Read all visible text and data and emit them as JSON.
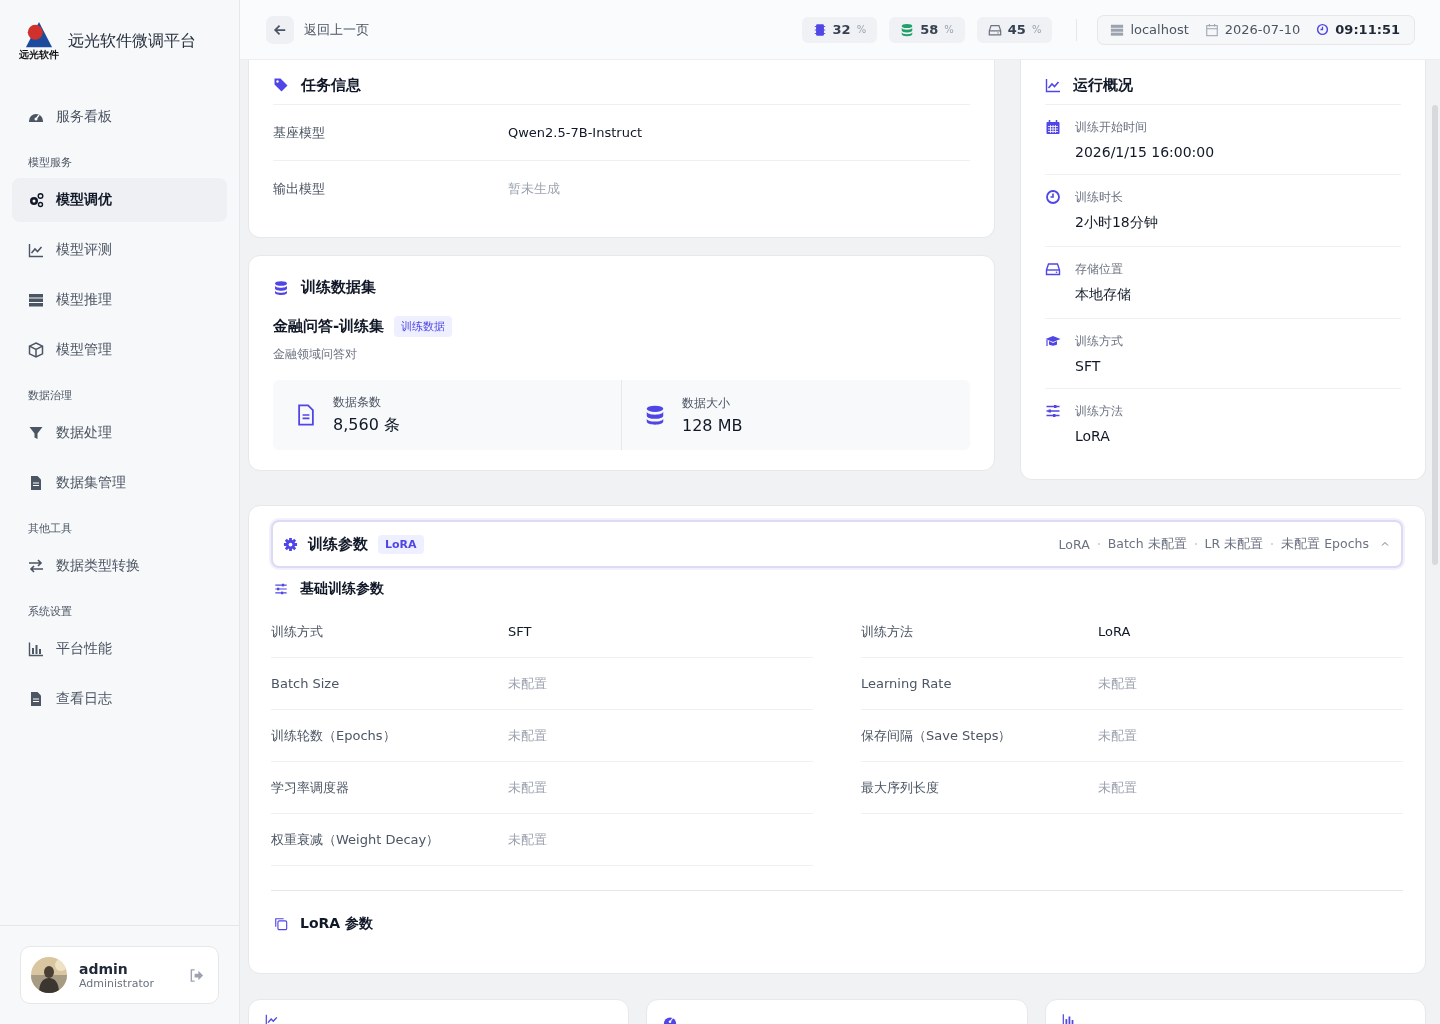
{
  "brand": {
    "logo_caption": "远光软件",
    "title": "远光软件微调平台"
  },
  "sidebar": {
    "items": [
      {
        "kind": "item",
        "label": "服务看板",
        "selected": false
      },
      {
        "kind": "section",
        "label": "模型服务"
      },
      {
        "kind": "item",
        "label": "模型调优",
        "selected": true
      },
      {
        "kind": "item",
        "label": "模型评测",
        "selected": false
      },
      {
        "kind": "item",
        "label": "模型推理",
        "selected": false
      },
      {
        "kind": "item",
        "label": "模型管理",
        "selected": false
      },
      {
        "kind": "section",
        "label": "数据治理"
      },
      {
        "kind": "item",
        "label": "数据处理",
        "selected": false
      },
      {
        "kind": "item",
        "label": "数据集管理",
        "selected": false
      },
      {
        "kind": "section",
        "label": "其他工具"
      },
      {
        "kind": "item",
        "label": "数据类型转换",
        "selected": false
      },
      {
        "kind": "section",
        "label": "系统设置"
      },
      {
        "kind": "item",
        "label": "平台性能",
        "selected": false
      },
      {
        "kind": "item",
        "label": "查看日志",
        "selected": false
      }
    ],
    "user": {
      "name": "admin",
      "role": "Administrator"
    }
  },
  "header": {
    "back": "返回上一页",
    "metrics": [
      {
        "kind": "gpu",
        "value": "32",
        "unit": "%"
      },
      {
        "kind": "db",
        "value": "58",
        "unit": "%"
      },
      {
        "kind": "disk",
        "value": "45",
        "unit": "%"
      }
    ],
    "host": "localhost",
    "date": "2026-07-10",
    "time": "09:11:51"
  },
  "task_info": {
    "title": "任务信息",
    "rows": [
      {
        "label": "基座模型",
        "value": "Qwen2.5-7B-Instruct",
        "muted": false
      },
      {
        "label": "输出模型",
        "value": "暂未生成",
        "muted": true
      }
    ]
  },
  "dataset": {
    "title": "训练数据集",
    "name": "金融问答-训练集",
    "tag": "训练数据",
    "description": "金融领域问答对",
    "stats": [
      {
        "kind": "file",
        "label": "数据条数",
        "value": "8,560 条"
      },
      {
        "kind": "db",
        "label": "数据大小",
        "value": "128 MB"
      }
    ]
  },
  "overview": {
    "title": "运行概况",
    "items": [
      {
        "label": "训练开始时间",
        "value": "2026/1/15 16:00:00"
      },
      {
        "label": "训练时长",
        "value": "2小时18分钟"
      },
      {
        "label": "存储位置",
        "value": "本地存储"
      },
      {
        "label": "训练方式",
        "value": "SFT"
      },
      {
        "label": "训练方法",
        "value": "LoRA"
      }
    ]
  },
  "params": {
    "title": "训练参数",
    "tag": "LoRA",
    "summary": [
      "LoRA",
      "Batch 未配置",
      "LR 未配置",
      "未配置 Epochs"
    ],
    "expanded": true,
    "basic_title": "基础训练参数",
    "fields": [
      {
        "label": "训练方式",
        "value": "SFT",
        "configured": true
      },
      {
        "label": "训练方法",
        "value": "LoRA",
        "configured": true
      },
      {
        "label": "Batch Size",
        "value": "未配置",
        "configured": false
      },
      {
        "label": "Learning Rate",
        "value": "未配置",
        "configured": false
      },
      {
        "label": "训练轮数（Epochs）",
        "value": "未配置",
        "configured": false
      },
      {
        "label": "保存间隔（Save Steps）",
        "value": "未配置",
        "configured": false
      },
      {
        "label": "学习率调度器",
        "value": "未配置",
        "configured": false
      },
      {
        "label": "最大序列长度",
        "value": "未配置",
        "configured": false
      },
      {
        "label": "权重衰减（Weight Decay）",
        "value": "未配置",
        "configured": false
      }
    ],
    "lora_title": "LoRA 参数"
  },
  "charts": [
    {
      "kind": "chart"
    },
    {
      "kind": "gauge"
    },
    {
      "kind": "bars"
    }
  ]
}
